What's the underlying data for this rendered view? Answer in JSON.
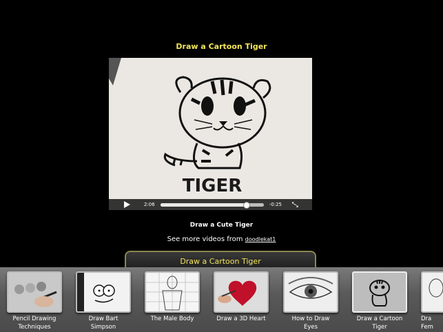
{
  "page": {
    "title": "Draw a Cartoon Tiger"
  },
  "player": {
    "frame_text": "TIGER",
    "elapsed": "2:06",
    "remaining": "-0:25",
    "progress": 0.83
  },
  "video": {
    "subtitle": "Draw a Cute Tiger",
    "more_prefix": "See more videos from",
    "author": "doodlekat1"
  },
  "now_playing": {
    "label": "Draw a Cartoon Tiger"
  },
  "carousel": {
    "items": [
      {
        "line1": "Pencil Drawing",
        "line2": "Techniques"
      },
      {
        "line1": "Draw Bart",
        "line2": "Simpson"
      },
      {
        "line1": "The Male Body",
        "line2": ""
      },
      {
        "line1": "Draw a 3D Heart",
        "line2": ""
      },
      {
        "line1": "How to Draw",
        "line2": "Eyes"
      },
      {
        "line1": "Draw a Cartoon",
        "line2": "Tiger"
      },
      {
        "line1": "Dra",
        "line2": "Fem"
      }
    ]
  },
  "colors": {
    "title": "#f4e55c",
    "background": "#000000"
  }
}
